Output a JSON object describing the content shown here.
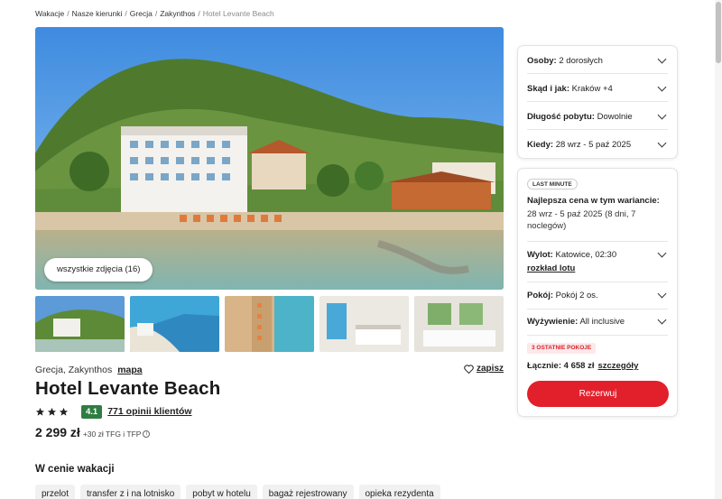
{
  "breadcrumb": [
    {
      "label": "Wakacje"
    },
    {
      "label": "Nasze kierunki"
    },
    {
      "label": "Grecja"
    },
    {
      "label": "Zakynthos"
    },
    {
      "label": "Hotel Levante Beach"
    }
  ],
  "gallery": {
    "all_photos_label": "wszystkie zdjęcia (16)"
  },
  "hotel": {
    "location": "Grecja, Zakynthos",
    "map_link": "mapa",
    "save_label": "zapisz",
    "name": "Hotel Levante Beach",
    "stars": 3,
    "score": "4.1",
    "reviews_link": "771 opinii klientów",
    "price": "2 299 zł",
    "price_extra": "+30 zł TFG i TFP"
  },
  "included": {
    "title": "W cenie wakacji",
    "items": [
      "przelot",
      "transfer z i na lotnisko",
      "pobyt w hotelu",
      "bagaż rejestrowany",
      "opieka rezydenta"
    ]
  },
  "search_panel": {
    "rows": [
      {
        "label": "Osoby:",
        "value": "2 dorosłych"
      },
      {
        "label": "Skąd i jak:",
        "value": "Kraków +4"
      },
      {
        "label": "Długość pobytu:",
        "value": "Dowolnie"
      },
      {
        "label": "Kiedy:",
        "value": "28 wrz - 5 paź 2025"
      }
    ]
  },
  "offer_panel": {
    "badge": "LAST MINUTE",
    "best_title": "Najlepsza cena w tym wariancie:",
    "best_dates": "28 wrz - 5 paź 2025 (8 dni, 7 noclegów)",
    "flight_label": "Wylot:",
    "flight_value": "Katowice, 02:30",
    "flight_link": "rozkład lotu",
    "room_label": "Pokój:",
    "room_value": "Pokój 2 os.",
    "board_label": "Wyżywienie:",
    "board_value": "All inclusive",
    "rooms_left_badge": "3 OSTATNIE POKOJE",
    "total_label": "Łącznie:",
    "total_value": "4 658 zł",
    "details_link": "szczegóły",
    "book_button": "Rezerwuj"
  },
  "colors": {
    "accent_red": "#e2202c",
    "score_green": "#2f7d42"
  }
}
